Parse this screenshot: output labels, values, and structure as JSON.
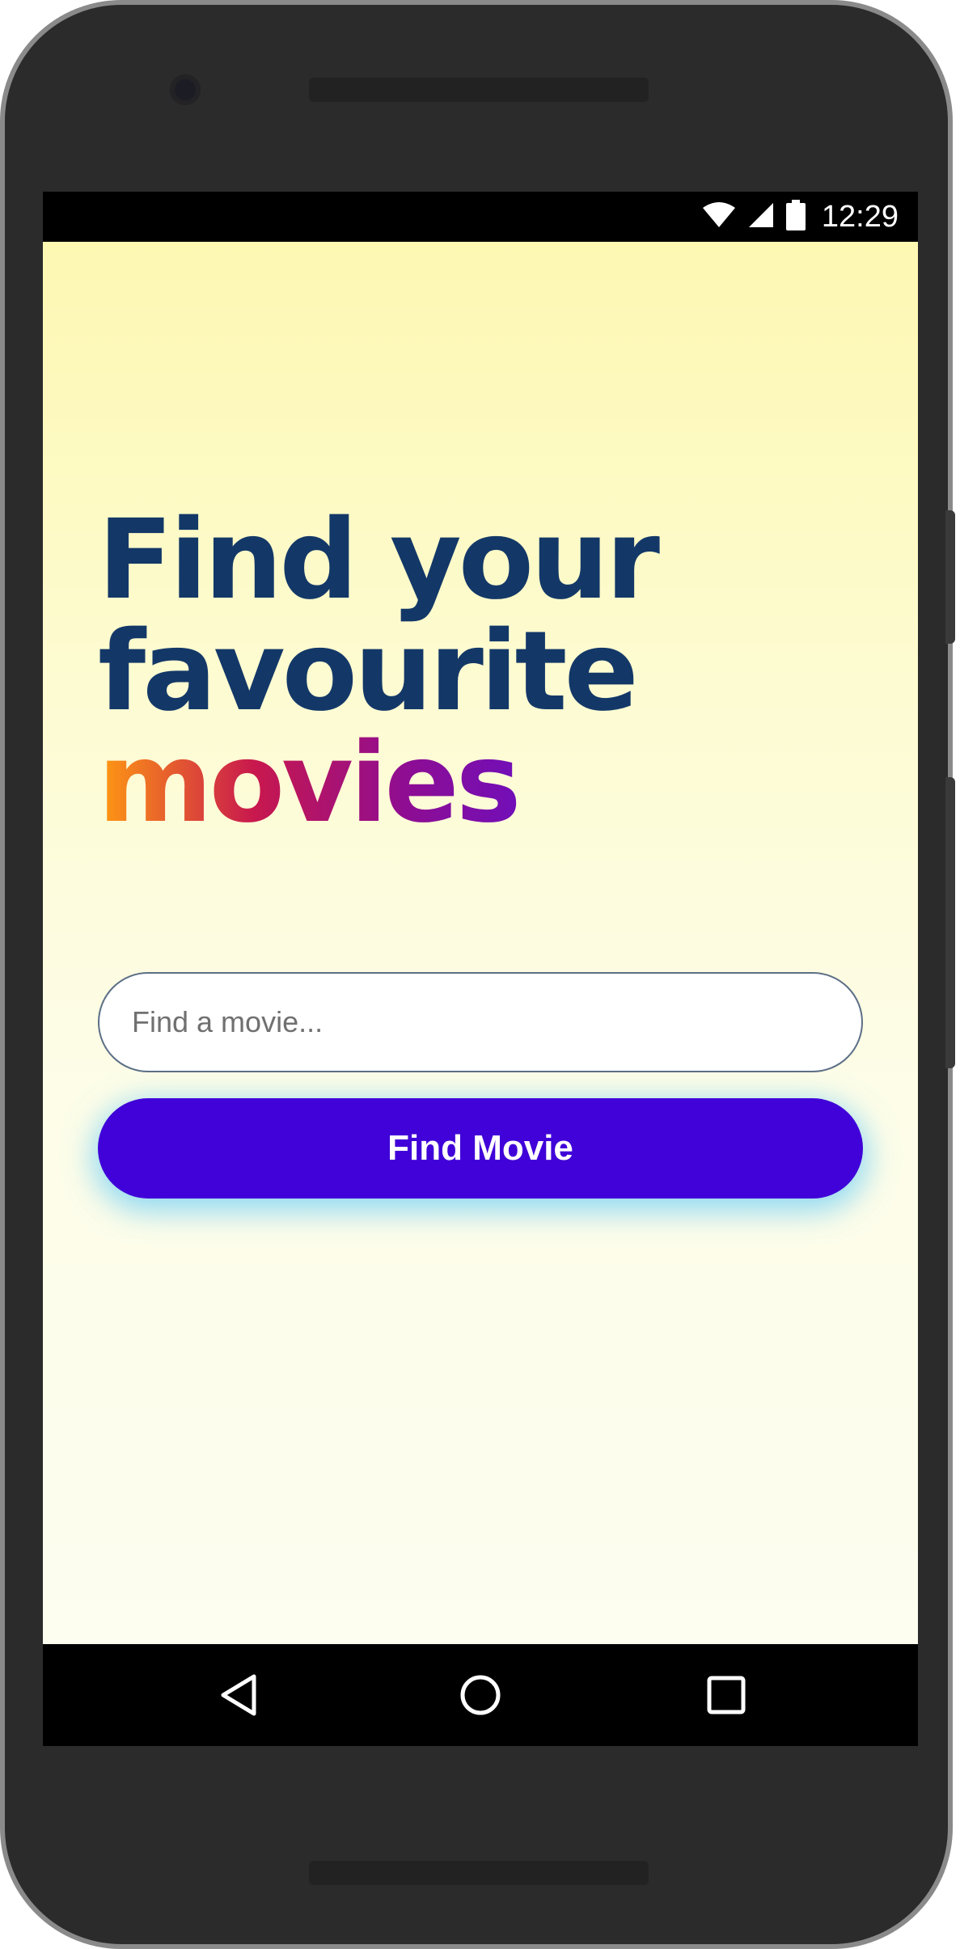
{
  "status_bar": {
    "time": "12:29",
    "icons": [
      "wifi-icon",
      "cell-signal-icon",
      "battery-icon"
    ]
  },
  "headline": {
    "line1": "Find your",
    "line2": "favourite",
    "line3": "movies"
  },
  "search": {
    "placeholder": "Find a movie...",
    "value": ""
  },
  "button": {
    "label": "Find Movie"
  },
  "nav_bar": {
    "icons": [
      "back-icon",
      "home-icon",
      "recents-icon"
    ]
  },
  "colors": {
    "headline": "#133868",
    "accent_gradient": [
      "#ff9a12",
      "#c8184e",
      "#8e0d92",
      "#4e10e8"
    ],
    "button_bg": "#4002d8",
    "button_glow": "#6ecdf5",
    "background_top": "#fdf8b2",
    "background_bottom": "#fdfdf0"
  }
}
